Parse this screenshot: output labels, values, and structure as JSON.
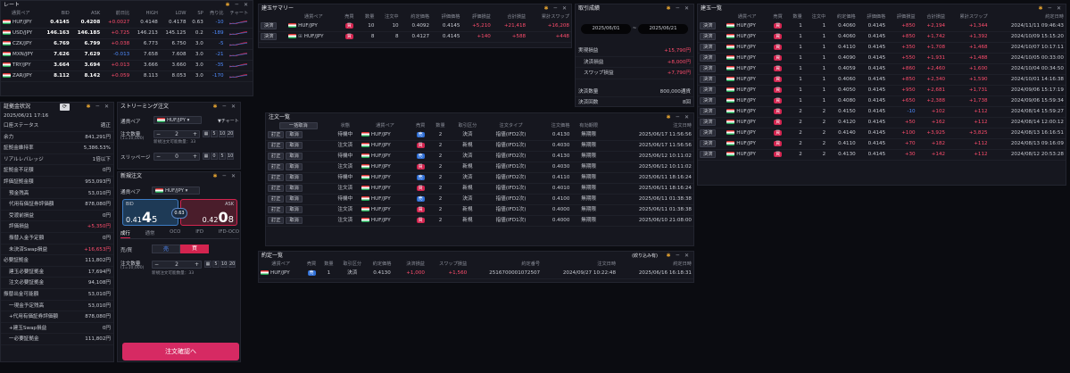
{
  "rate": {
    "title": "レート",
    "headers": [
      "通貨ペア",
      "BID",
      "ASK",
      "前日比",
      "HIGH",
      "LOW",
      "SP",
      "売り比",
      "チャート"
    ],
    "rows": [
      {
        "pair": "HUF/JPY",
        "bid": "0.4145",
        "ask": "0.4208",
        "chg": "+0.0027",
        "high": "0.4148",
        "low": "0.4178",
        "sp": "0.63",
        "ratio": "-10"
      },
      {
        "pair": "USD/JPY",
        "bid": "146.163",
        "ask": "146.185",
        "chg": "+0.725",
        "high": "146.213",
        "low": "145.125",
        "sp": "0.2",
        "ratio": "-189"
      },
      {
        "pair": "CZK/JPY",
        "bid": "6.769",
        "ask": "6.799",
        "chg": "+0.038",
        "high": "6.773",
        "low": "6.750",
        "sp": "3.0",
        "ratio": "-5"
      },
      {
        "pair": "MXN/JPY",
        "bid": "7.626",
        "ask": "7.629",
        "chg": "-0.013",
        "high": "7.658",
        "low": "7.608",
        "sp": "3.0",
        "ratio": "-21"
      },
      {
        "pair": "TRY/JPY",
        "bid": "3.664",
        "ask": "3.694",
        "chg": "+0.013",
        "high": "3.666",
        "low": "3.660",
        "sp": "3.0",
        "ratio": "-35"
      },
      {
        "pair": "ZAR/JPY",
        "bid": "8.112",
        "ask": "8.142",
        "chg": "+0.059",
        "high": "8.113",
        "low": "8.053",
        "sp": "3.0",
        "ratio": "-170"
      }
    ]
  },
  "margin": {
    "title": "証拠金状況",
    "date": "2025/06/21 17:16",
    "items": [
      {
        "k": "口座ステータス",
        "v": "適正"
      },
      {
        "k": "余力",
        "v": "841,291円"
      },
      {
        "k": "証拠金維持率",
        "v": "5,386.53%"
      },
      {
        "k": "リアルレバレッジ",
        "v": "1倍以下"
      },
      {
        "k": "証拠金不足額",
        "v": "0円"
      },
      {
        "k": "評価証拠金額",
        "v": "953,093円"
      },
      {
        "k": "預金残高",
        "v": "53,010円",
        "sub": true
      },
      {
        "k": "代用有価証券評価額",
        "v": "878,080円",
        "sub": true
      },
      {
        "k": "受渡前損益",
        "v": "0円",
        "sub": true
      },
      {
        "k": "評価損益",
        "v": "+5,350円",
        "sub": true,
        "cls": "pos"
      },
      {
        "k": "振替入金予定額",
        "v": "0円",
        "sub": true
      },
      {
        "k": "未決済Swap損益",
        "v": "+16,653円",
        "sub": true,
        "cls": "pos"
      },
      {
        "k": "必要証拠金",
        "v": "111,802円"
      },
      {
        "k": "建玉必要証拠金",
        "v": "17,694円",
        "sub": true
      },
      {
        "k": "注文必要証拠金",
        "v": "94,108円",
        "sub": true
      },
      {
        "k": "振替出金可能額",
        "v": "53,010円"
      },
      {
        "k": "一現金予定残高",
        "v": "53,010円",
        "sub": true
      },
      {
        "k": "+代用有価証券評価額",
        "v": "878,080円",
        "sub": true
      },
      {
        "k": "+建玉Swap損益",
        "v": "0円",
        "sub": true
      },
      {
        "k": "一必要証拠金",
        "v": "111,802円",
        "sub": true
      }
    ]
  },
  "stream": {
    "title": "ストリーミング注文",
    "pair_label": "通貨ペア",
    "pair": "HUF/JPY",
    "chart_link": "▼チャート",
    "qty_label": "注文数量",
    "qty_unit": "(1=10,000)",
    "qty": "2",
    "qty_note": "新規注文可能数量：33",
    "slip_label": "スリッページ",
    "slip": "0",
    "slip_unit": "pips"
  },
  "neworder": {
    "title": "新規注文",
    "pair_label": "通貨ペア",
    "pair": "HUF/JPY",
    "bid_label": "BID",
    "ask_label": "ASK",
    "bid_pre": "0.41",
    "bid_big": "4",
    "bid_small": "5",
    "ask_pre": "0.42",
    "ask_big": "0",
    "ask_small": "8",
    "spread": "0.63",
    "tabs": [
      "成行",
      "通常",
      "OCO",
      "IFD",
      "IFD-OCO"
    ],
    "side_label": "売/買",
    "sell": "売",
    "buy": "買",
    "qty_label": "注文数量",
    "qty_unit": "(1=10,000)",
    "qty": "2",
    "qty_note": "新規注文可能数量：33",
    "steps": [
      "5",
      "10",
      "20"
    ],
    "confirm": "注文確認へ"
  },
  "summary": {
    "title": "建玉サマリー",
    "headers": [
      "",
      "通貨ペア",
      "売買",
      "数量",
      "注文中",
      "約定価格",
      "評価価格",
      "評価損益",
      "合計損益",
      "累計スワップ"
    ],
    "rows": [
      {
        "btn": "決済",
        "pair": "HUF/JPY",
        "side": "買",
        "qty": "10",
        "ord": "10",
        "price": "0.4092",
        "eval": "0.4145",
        "pl": "+5,210",
        "total": "+21,418",
        "swap": "+16,208"
      },
      {
        "btn": "決済",
        "pair": "HUF/JPY",
        "side": "買",
        "qty": "8",
        "ord": "8",
        "price": "0.4127",
        "eval": "0.4145",
        "pl": "+140",
        "total": "+588",
        "swap": "+448"
      }
    ]
  },
  "result": {
    "title": "取引成績",
    "from": "2025/06/01",
    "to": "2025/06/21",
    "items": [
      {
        "k": "実現損益",
        "v": "+15,790円",
        "cls": "pos"
      },
      {
        "k": "決済損益",
        "v": "+8,000円",
        "cls": "pos",
        "sub": true
      },
      {
        "k": "スワップ損益",
        "v": "+7,790円",
        "cls": "pos",
        "sub": true
      },
      {
        "k": "決済数量",
        "v": "800,000通貨"
      },
      {
        "k": "決済回数",
        "v": "8回"
      }
    ]
  },
  "orders": {
    "title": "注文一覧",
    "bulk_cancel": "一括取消",
    "headers": [
      "",
      "状態",
      "通貨ペア",
      "売買",
      "数量",
      "取引区分",
      "注文タイプ",
      "注文価格",
      "有効期限",
      "注文日時"
    ],
    "rows": [
      {
        "state": "待機中",
        "side": "売",
        "qty": "2",
        "kind": "決済",
        "type": "指値(IFD2次)",
        "price": "0.4130",
        "exp": "無期限",
        "date": "2025/06/17 11:56:56"
      },
      {
        "state": "注文済",
        "side": "買",
        "qty": "2",
        "kind": "新規",
        "type": "指値(IFD1次)",
        "price": "0.4030",
        "exp": "無期限",
        "date": "2025/06/17 11:56:56"
      },
      {
        "state": "待機中",
        "side": "売",
        "qty": "2",
        "kind": "決済",
        "type": "指値(IFD2次)",
        "price": "0.4130",
        "exp": "無期限",
        "date": "2025/06/12 10:11:02"
      },
      {
        "state": "注文済",
        "side": "買",
        "qty": "2",
        "kind": "新規",
        "type": "指値(IFD1次)",
        "price": "0.4030",
        "exp": "無期限",
        "date": "2025/06/12 10:11:02"
      },
      {
        "state": "待機中",
        "side": "売",
        "qty": "2",
        "kind": "決済",
        "type": "指値(IFD2次)",
        "price": "0.4110",
        "exp": "無期限",
        "date": "2025/06/11 18:16:24"
      },
      {
        "state": "注文済",
        "side": "買",
        "qty": "2",
        "kind": "新規",
        "type": "指値(IFD1次)",
        "price": "0.4010",
        "exp": "無期限",
        "date": "2025/06/11 18:16:24"
      },
      {
        "state": "待機中",
        "side": "売",
        "qty": "2",
        "kind": "決済",
        "type": "指値(IFD2次)",
        "price": "0.4100",
        "exp": "無期限",
        "date": "2025/06/11 01:38:38"
      },
      {
        "state": "注文済",
        "side": "買",
        "qty": "2",
        "kind": "新規",
        "type": "指値(IFD1次)",
        "price": "0.4000",
        "exp": "無期限",
        "date": "2025/06/11 01:38:38"
      },
      {
        "state": "注文済",
        "side": "買",
        "qty": "2",
        "kind": "新規",
        "type": "指値(IFD1次)",
        "price": "0.4000",
        "exp": "無期限",
        "date": "2025/06/10 21:08:00"
      }
    ],
    "btn_mod": "訂正",
    "btn_cancel": "取消",
    "pair": "HUF/JPY"
  },
  "exec": {
    "title": "約定一覧",
    "filter": "(絞り込み有)",
    "headers": [
      "通貨ペア",
      "売買",
      "数量",
      "取引区分",
      "約定価格",
      "決済損益",
      "スワップ損益",
      "約定番号",
      "注文日時",
      "約定日時"
    ],
    "rows": [
      {
        "pair": "HUF/JPY",
        "side": "売",
        "qty": "1",
        "kind": "決済",
        "price": "0.4130",
        "pl": "+1,000",
        "swap": "+1,560",
        "no": "2516700001072507",
        "odate": "2024/09/27 10:22:48",
        "edate": "2025/06/16 16:18:31"
      }
    ]
  },
  "positions": {
    "title": "建玉一覧",
    "headers": [
      "",
      "通貨ペア",
      "売買",
      "数量",
      "注文中",
      "約定価格",
      "評価価格",
      "評価損益",
      "合計損益",
      "累計スワップ",
      "約定日時"
    ],
    "rows": [
      {
        "qty": "1",
        "ord": "1",
        "price": "0.4060",
        "eval": "0.4145",
        "pl": "+850",
        "total": "+2,194",
        "swap": "+1,344",
        "date": "2024/11/11 09:46:43"
      },
      {
        "qty": "1",
        "ord": "1",
        "price": "0.4060",
        "eval": "0.4145",
        "pl": "+850",
        "total": "+1,742",
        "swap": "+1,392",
        "date": "2024/10/09 15:15:20"
      },
      {
        "qty": "1",
        "ord": "1",
        "price": "0.4110",
        "eval": "0.4145",
        "pl": "+350",
        "total": "+1,708",
        "swap": "+1,468",
        "date": "2024/10/07 10:17:11"
      },
      {
        "qty": "1",
        "ord": "1",
        "price": "0.4090",
        "eval": "0.4145",
        "pl": "+550",
        "total": "+1,931",
        "swap": "+1,488",
        "date": "2024/10/05 00:33:00"
      },
      {
        "qty": "1",
        "ord": "1",
        "price": "0.4059",
        "eval": "0.4145",
        "pl": "+860",
        "total": "+2,460",
        "swap": "+1,600",
        "date": "2024/10/04 00:34:50"
      },
      {
        "qty": "1",
        "ord": "1",
        "price": "0.4060",
        "eval": "0.4145",
        "pl": "+850",
        "total": "+2,340",
        "swap": "+1,590",
        "date": "2024/10/01 14:16:38"
      },
      {
        "qty": "1",
        "ord": "1",
        "price": "0.4050",
        "eval": "0.4145",
        "pl": "+950",
        "total": "+2,681",
        "swap": "+1,731",
        "date": "2024/09/06 15:17:19"
      },
      {
        "qty": "1",
        "ord": "1",
        "price": "0.4080",
        "eval": "0.4145",
        "pl": "+650",
        "total": "+2,388",
        "swap": "+1,738",
        "date": "2024/09/06 15:59:34"
      },
      {
        "qty": "2",
        "ord": "2",
        "price": "0.4150",
        "eval": "0.4145",
        "pl": "-10",
        "total": "+102",
        "swap": "+112",
        "date": "2024/08/14 15:59:27"
      },
      {
        "qty": "2",
        "ord": "2",
        "price": "0.4120",
        "eval": "0.4145",
        "pl": "+50",
        "total": "+162",
        "swap": "+112",
        "date": "2024/08/14 12:00:12"
      },
      {
        "qty": "2",
        "ord": "2",
        "price": "0.4140",
        "eval": "0.4145",
        "pl": "+100",
        "total": "+3,925",
        "swap": "+3,825",
        "date": "2024/08/13 16:16:51"
      },
      {
        "qty": "2",
        "ord": "2",
        "price": "0.4110",
        "eval": "0.4145",
        "pl": "+70",
        "total": "+182",
        "swap": "+112",
        "date": "2024/08/13 09:16:09"
      },
      {
        "qty": "2",
        "ord": "2",
        "price": "0.4130",
        "eval": "0.4145",
        "pl": "+30",
        "total": "+142",
        "swap": "+112",
        "date": "2024/08/12 20:53:28"
      }
    ],
    "btn": "決済",
    "pair": "HUF/JPY",
    "side": "買"
  }
}
